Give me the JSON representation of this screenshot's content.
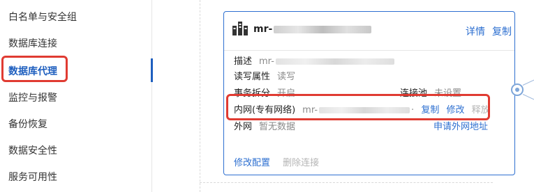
{
  "sidebar": {
    "items": [
      {
        "label": "白名单与安全组"
      },
      {
        "label": "数据库连接"
      },
      {
        "label": "数据库代理"
      },
      {
        "label": "监控与报警"
      },
      {
        "label": "备份恢复"
      },
      {
        "label": "数据安全性"
      },
      {
        "label": "服务可用性"
      }
    ],
    "active_index": 2
  },
  "card": {
    "icon": "database-cluster-icon",
    "instance_name_prefix": "mr-",
    "details_link": "详情",
    "copy_link": "复制",
    "description": {
      "label": "描述",
      "value_prefix": "mr-"
    },
    "rw_attr": {
      "label": "读写属性",
      "value": "读写"
    },
    "txn_split": {
      "label": "事务拆分",
      "value": "开启"
    },
    "conn_pool": {
      "label": "连接池",
      "value": "未设置"
    },
    "intranet": {
      "label": "内网(专有网络)",
      "value_prefix": "mr-",
      "ellipsis": "·",
      "copy": "复制",
      "modify": "修改",
      "release": "释放"
    },
    "internet": {
      "label": "外网",
      "value": "暂无数据",
      "apply": "申请外网地址"
    },
    "footer": {
      "modify_config": "修改配置",
      "delete_conn": "删除连接"
    }
  },
  "colors": {
    "accent": "#2d6fd0",
    "highlight": "#e03b32"
  }
}
